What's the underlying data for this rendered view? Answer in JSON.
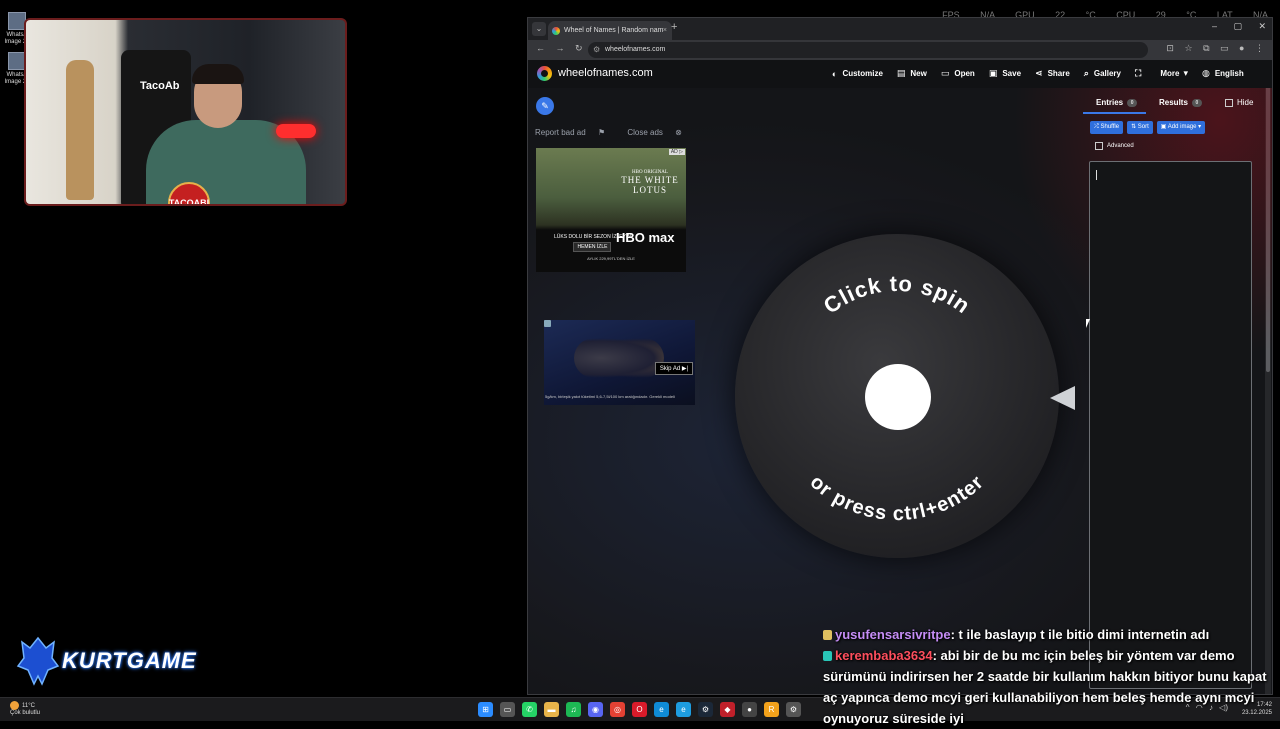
{
  "desktop": {
    "icons": [
      {
        "label": "WhatsA Image 20"
      },
      {
        "label": "WhatsA Image 20"
      }
    ]
  },
  "hud": {
    "text": "FPS N/A GPU 22 °C CPU 29 °C LAT N/A"
  },
  "webcam": {
    "chair_label": "TacoAb",
    "badge": "TACOABI"
  },
  "stream_logo": {
    "text": "KURTGAME"
  },
  "browser": {
    "tab_title": "Wheel of Names | Random nam",
    "url": "wheelofnames.com",
    "window_controls": "– ▢ ✕"
  },
  "site": {
    "brand": "wheelofnames.com",
    "menu": [
      {
        "icon": "palette-icon",
        "glyph": "◐",
        "label": "Customize"
      },
      {
        "icon": "file-icon",
        "glyph": "▤",
        "label": "New"
      },
      {
        "icon": "folder-icon",
        "glyph": "▭",
        "label": "Open"
      },
      {
        "icon": "save-icon",
        "glyph": "▣",
        "label": "Save"
      },
      {
        "icon": "share-icon",
        "glyph": "⋖",
        "label": "Share"
      },
      {
        "icon": "search-icon",
        "glyph": "⌕",
        "label": "Gallery"
      },
      {
        "icon": "fullscreen-icon",
        "glyph": "⛶",
        "label": ""
      },
      {
        "icon": "chevron-down-icon",
        "glyph": "▾",
        "label": "More"
      },
      {
        "icon": "globe-icon",
        "glyph": "◍",
        "label": "English"
      }
    ],
    "ad_links": {
      "report": "Report bad ad",
      "close": "Close ads"
    },
    "ad1": {
      "title_small": "HBO ORIGINAL",
      "title": "THE WHITE LOTUS",
      "promo": "LÜKS DOLU BİR SEZON İZLEYİN",
      "promo_button": "HEMEN İZLE",
      "hbo": "HBO max",
      "price": "AYLIK 229,99TL'DEN İZLE"
    },
    "ad2": {
      "skip": "Skip Ad ▶|",
      "caption": "5g/km, birleşik yakıt tüketimi 5,6-7,5l/100 km aralığındadır. Gerekli modeli"
    },
    "wheel": {
      "top_text": "Click to spin",
      "bottom_text": "or press ctrl+enter"
    },
    "panel": {
      "entries_label": "Entries",
      "entries_count": "0",
      "results_label": "Results",
      "results_count": "0",
      "hide_label": "Hide",
      "shuffle": "Shuffle",
      "sort": "Sort",
      "add_image": "Add image",
      "advanced": "Advanced"
    }
  },
  "chat": [
    {
      "user": "yusufensarsivritpe",
      "message": ": t ile baslayıp t ile bitio dimi internetin adı",
      "badge_color": "#e0c060"
    },
    {
      "user": "kerembaba3634",
      "message": ": abi bir de bu mc için beleş bir yöntem var demo sürümünü indirirsen her 2 saatde bir kullanım hakkın bitiyor bunu kapat aç yapınca demo mcyi geri kullanabiliyon hem beleş hemde aynı mcyi oynuyoruz süreside iyi",
      "badge_color": "#29c6b8"
    }
  ],
  "taskbar": {
    "weather_temp": "11°C",
    "weather_desc": "Çok bulutlu",
    "time": "17:42",
    "date": "23.12.2025",
    "apps": [
      {
        "name": "start-icon",
        "glyph": "⊞",
        "color": "#2b8cff"
      },
      {
        "name": "task-view-icon",
        "glyph": "▭",
        "color": "#555"
      },
      {
        "name": "whatsapp-icon",
        "glyph": "✆",
        "color": "#25d366"
      },
      {
        "name": "file-explorer-icon",
        "glyph": "▬",
        "color": "#e8b44a"
      },
      {
        "name": "spotify-icon",
        "glyph": "♫",
        "color": "#1db954"
      },
      {
        "name": "discord-icon",
        "glyph": "◉",
        "color": "#5865f2"
      },
      {
        "name": "chrome-icon",
        "glyph": "◎",
        "color": "#e34133"
      },
      {
        "name": "opera-icon",
        "glyph": "O",
        "color": "#d91b2a"
      },
      {
        "name": "edge-icon",
        "glyph": "e",
        "color": "#0f8bd6"
      },
      {
        "name": "edge-alt-icon",
        "glyph": "e",
        "color": "#1e9de0"
      },
      {
        "name": "steam-icon",
        "glyph": "⚙",
        "color": "#1b2838"
      },
      {
        "name": "app-red-icon",
        "glyph": "◆",
        "color": "#c0202a"
      },
      {
        "name": "obs-icon",
        "glyph": "●",
        "color": "#444"
      },
      {
        "name": "rockstar-icon",
        "glyph": "R",
        "color": "#f3a21b"
      },
      {
        "name": "settings-icon",
        "glyph": "⚙",
        "color": "#555"
      }
    ]
  }
}
